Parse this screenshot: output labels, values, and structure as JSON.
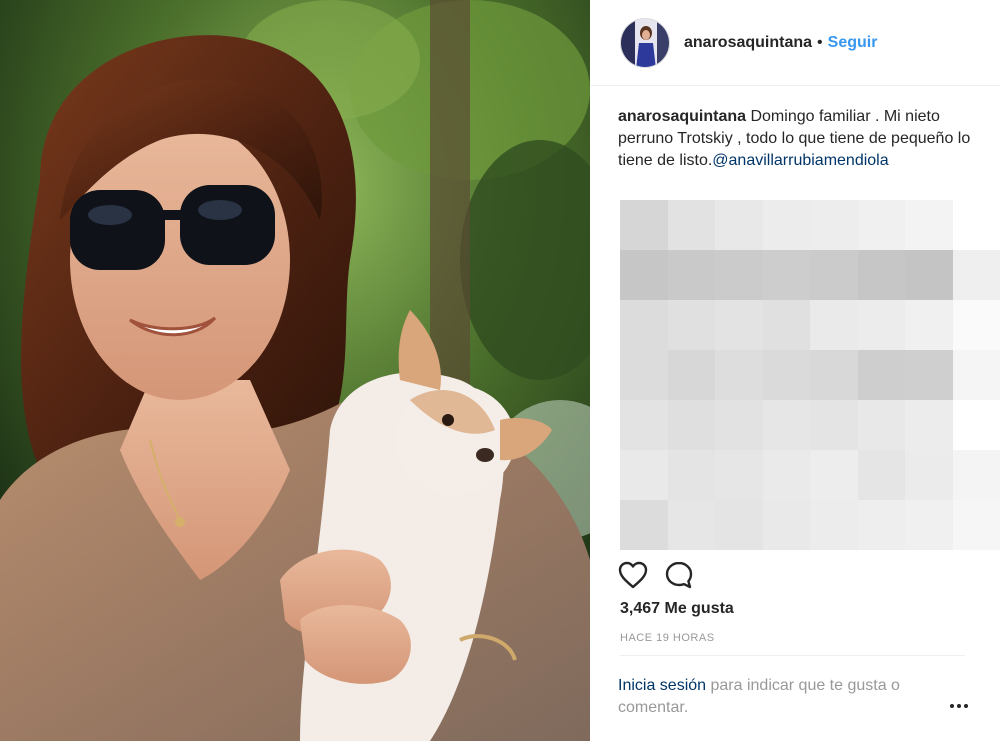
{
  "post": {
    "username": "anarosaquintana",
    "separator": "•",
    "follow_label": "Seguir",
    "caption": {
      "username": "anarosaquintana",
      "text": " Domingo familiar . Mi nieto perruno Trotskiy , todo lo que tiene de pequeño lo tiene de listo.",
      "mention": "@anavillarrubiamendiola"
    },
    "likes": "3,467 Me gusta",
    "timestamp": "HACE 19 HORAS",
    "login_prompt": {
      "link": "Inicia sesión",
      "text": " para indicar que te gusta o comentar."
    }
  },
  "icons": {
    "like": "heart-icon",
    "comment": "comment-icon",
    "more": "more-options-icon"
  },
  "colors": {
    "link_blue": "#3897f0",
    "mention_navy": "#003569",
    "text": "#262626",
    "muted": "#999999"
  }
}
